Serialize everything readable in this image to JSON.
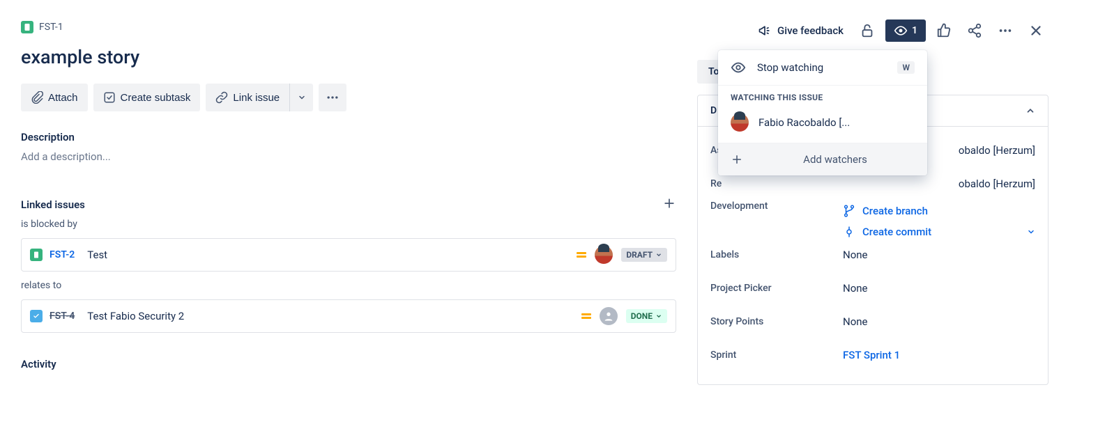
{
  "breadcrumb": {
    "key": "FST-1"
  },
  "title": "example story",
  "toolbar": {
    "attach": "Attach",
    "create_subtask": "Create subtask",
    "link_issue": "Link issue"
  },
  "description": {
    "label": "Description",
    "placeholder": "Add a description..."
  },
  "linked": {
    "header": "Linked issues",
    "groups": [
      {
        "label": "is blocked by",
        "items": [
          {
            "key": "FST-2",
            "summary": "Test",
            "status": "DRAFT",
            "status_class": "draft",
            "icon": "story",
            "strike": false,
            "assigned": true
          }
        ]
      },
      {
        "label": "relates to",
        "items": [
          {
            "key": "FST-4",
            "summary": "Test Fabio Security 2",
            "status": "DONE",
            "status_class": "done",
            "icon": "task",
            "strike": true,
            "assigned": false
          }
        ]
      }
    ]
  },
  "activity": {
    "header": "Activity"
  },
  "top_actions": {
    "feedback": "Give feedback",
    "watch_count": "1"
  },
  "popover": {
    "stop_watching": "Stop watching",
    "shortcut": "W",
    "watching_header": "WATCHING THIS ISSUE",
    "watcher": "Fabio Racobaldo [...",
    "add_watchers": "Add watchers"
  },
  "status_button": "To",
  "details": {
    "header_letter": "D",
    "assignee": {
      "label": "As",
      "value": "obaldo [Herzum]"
    },
    "reporter": {
      "label": "Re",
      "value": "obaldo [Herzum]"
    },
    "development": {
      "label": "Development",
      "create_branch": "Create branch",
      "create_commit": "Create commit"
    },
    "labels": {
      "label": "Labels",
      "value": "None"
    },
    "project_picker": {
      "label": "Project Picker",
      "value": "None"
    },
    "story_points": {
      "label": "Story Points",
      "value": "None"
    },
    "sprint": {
      "label": "Sprint",
      "value": "FST Sprint 1"
    }
  }
}
